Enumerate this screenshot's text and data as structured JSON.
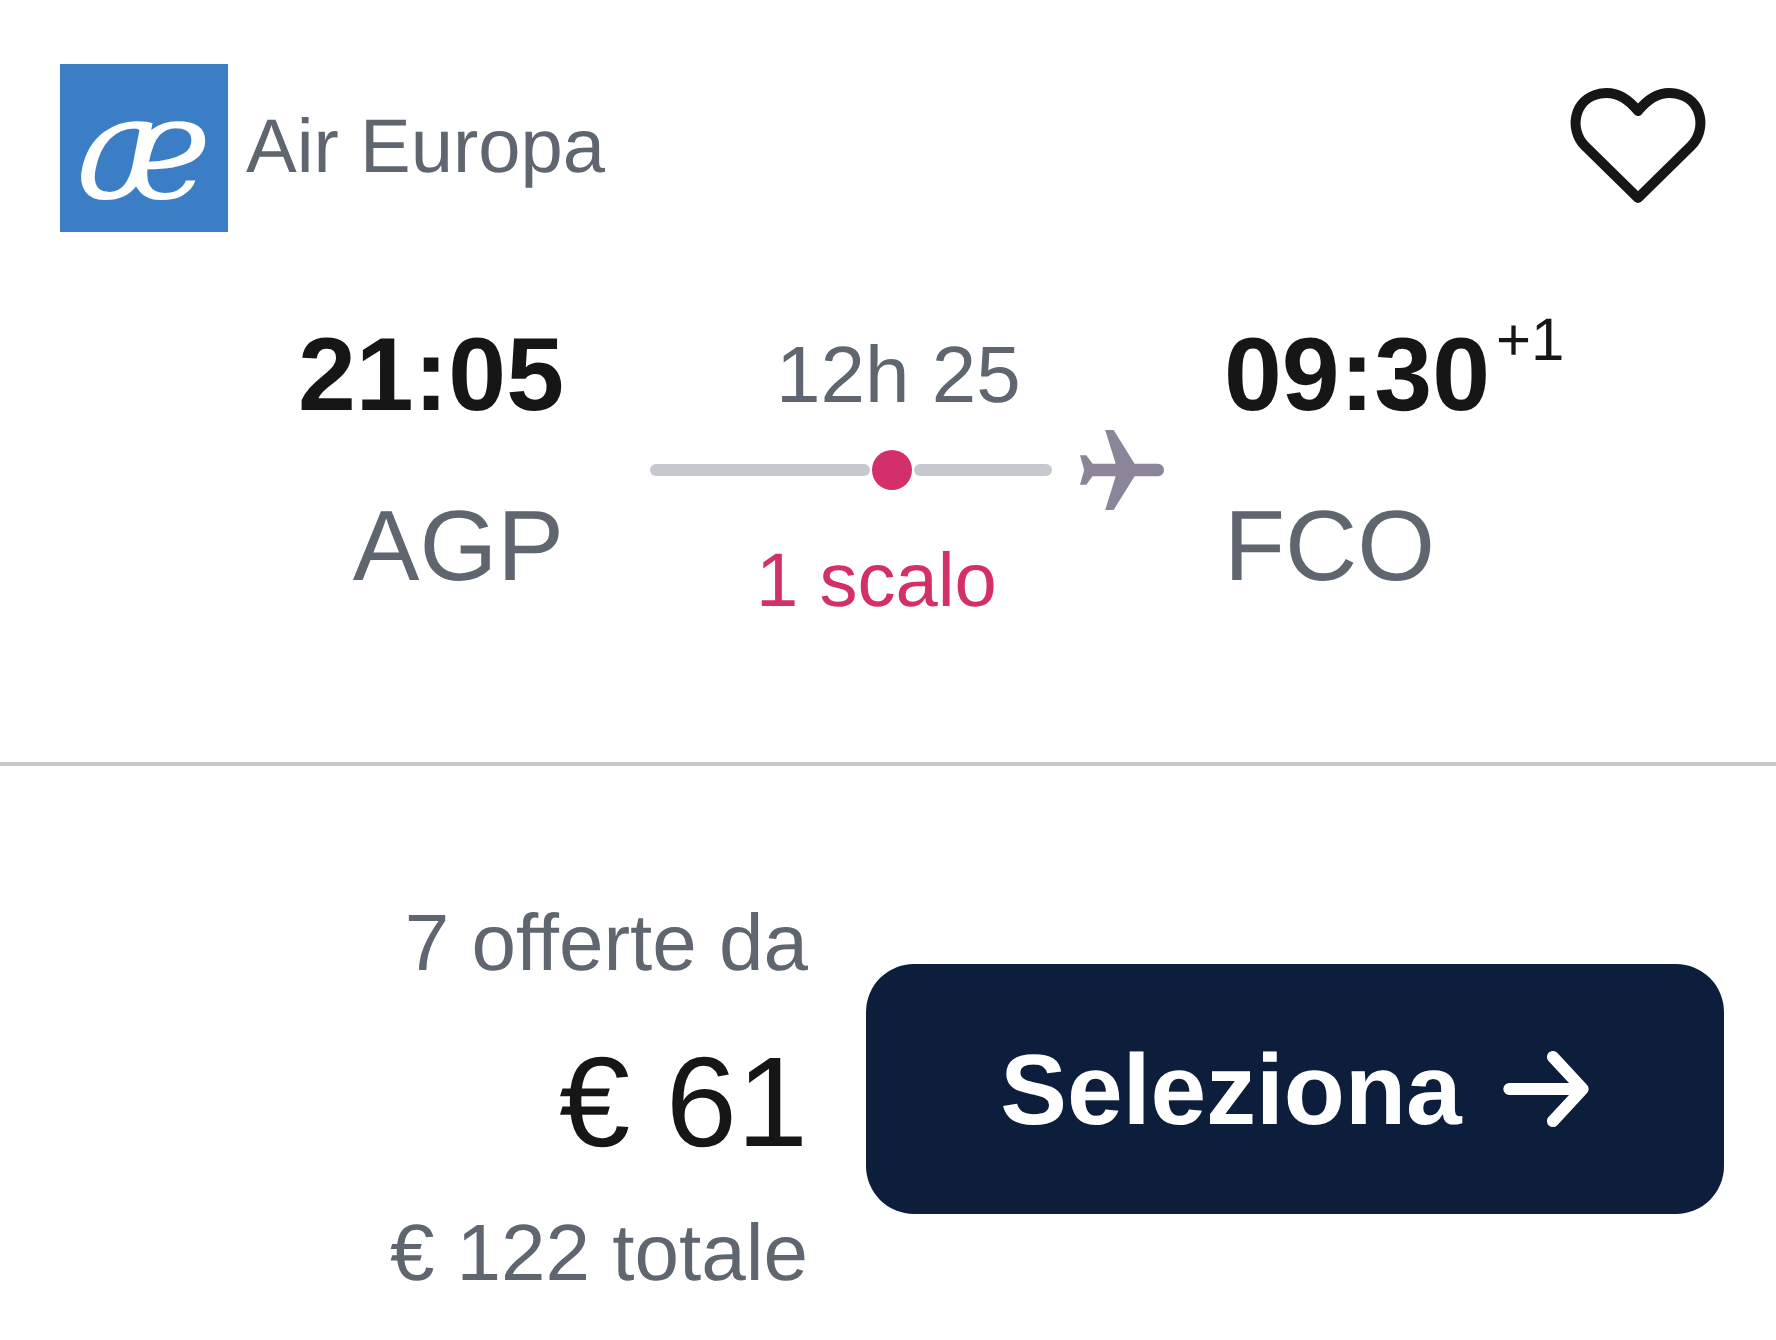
{
  "airline": {
    "logo_mark": "æ",
    "name": "Air Europa"
  },
  "favorite": {
    "on": false
  },
  "flight": {
    "departure": {
      "time": "21:05",
      "airport": "AGP"
    },
    "duration": "12h 25",
    "stops": "1 scalo",
    "arrival": {
      "time": "09:30",
      "day_offset": "+1",
      "airport": "FCO"
    }
  },
  "price": {
    "offers": "7 offerte da",
    "amount": "€ 61",
    "total": "€ 122 totale"
  },
  "button": {
    "label": "Seleziona"
  }
}
